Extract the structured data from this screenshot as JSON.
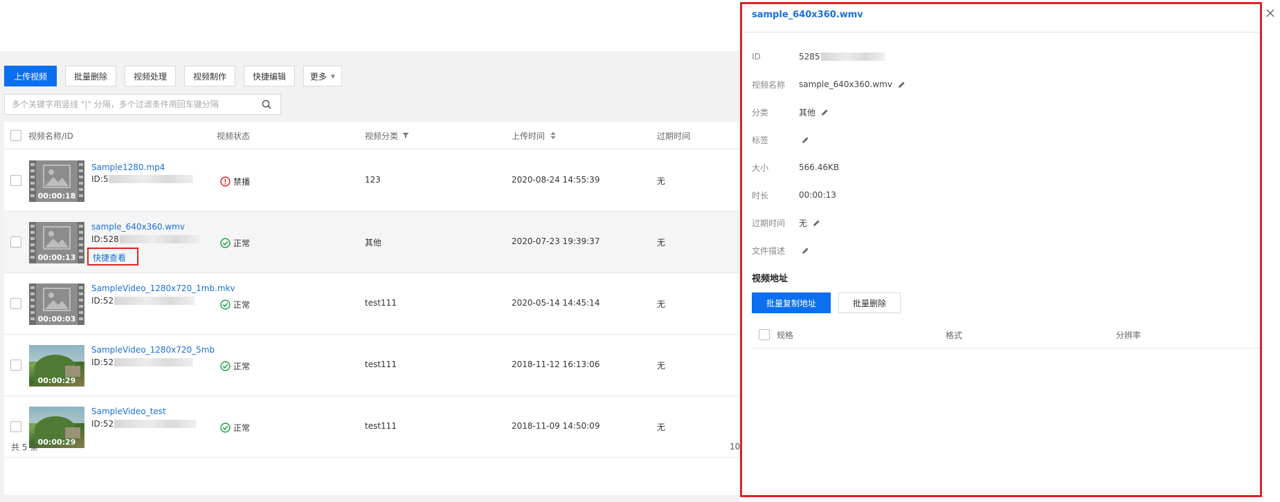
{
  "toolbar": {
    "upload": "上传视频",
    "batch_delete": "批量删除",
    "video_process": "视频处理",
    "video_make": "视频制作",
    "quick_edit": "快捷编辑",
    "more": "更多"
  },
  "search": {
    "placeholder": "多个关键字用竖线 \"|\" 分隔，多个过滤条件用回车键分隔"
  },
  "table": {
    "columns": {
      "name": "视频名称/ID",
      "status": "视频状态",
      "category": "视频分类",
      "upload_time": "上传时间",
      "expire": "过期时间"
    },
    "rows": [
      {
        "name": "Sample1280.mp4",
        "id_prefix": "ID:5",
        "duration": "00:00:18",
        "status": "禁播",
        "status_kind": "banned",
        "category": "123",
        "upload_time": "2020-08-24 14:55:39",
        "expire": "无"
      },
      {
        "name": "sample_640x360.wmv",
        "id_prefix": "ID:528",
        "duration": "00:00:13",
        "status": "正常",
        "status_kind": "ok",
        "category": "其他",
        "upload_time": "2020-07-23 19:39:37",
        "expire": "无",
        "quick_view": "快捷查看"
      },
      {
        "name": "SampleVideo_1280x720_1mb.mkv",
        "id_prefix": "ID:52",
        "duration": "00:00:03",
        "status": "正常",
        "status_kind": "ok",
        "category": "test111",
        "upload_time": "2020-05-14 14:45:14",
        "expire": "无"
      },
      {
        "name": "SampleVideo_1280x720_5mb",
        "id_prefix": "ID:52",
        "duration": "00:00:29",
        "status": "正常",
        "status_kind": "ok",
        "category": "test111",
        "upload_time": "2018-11-12 16:13:06",
        "expire": "无"
      },
      {
        "name": "SampleVideo_test",
        "id_prefix": "ID:52",
        "duration": "00:00:29",
        "status": "正常",
        "status_kind": "ok",
        "category": "test111",
        "upload_time": "2018-11-09 14:50:09",
        "expire": "无"
      }
    ],
    "total": "共 5 条",
    "page_size": "10"
  },
  "panel": {
    "title": "sample_640x360.wmv",
    "fields": {
      "id_label": "ID",
      "id_value": "5285",
      "name_label": "视频名称",
      "name_value": "sample_640x360.wmv",
      "category_label": "分类",
      "category_value": "其他",
      "tag_label": "标签",
      "size_label": "大小",
      "size_value": "566.46KB",
      "duration_label": "时长",
      "duration_value": "00:00:13",
      "expire_label": "过期时间",
      "expire_value": "无",
      "desc_label": "文件描述"
    },
    "address_section": "视频地址",
    "copy_button": "批量复制地址",
    "delete_button": "批量删除",
    "columns": {
      "spec": "规格",
      "format": "格式",
      "resolution": "分辨率"
    }
  },
  "colors": {
    "primary": "#0a6ff0",
    "link": "#1a6fd8",
    "highlight_border": "#e02020",
    "ok": "#1aa34a",
    "banned": "#e02020"
  },
  "icons": [
    "search-icon",
    "filter-icon",
    "sort-icon",
    "edit-icon",
    "close-icon",
    "check-circle-icon",
    "alert-circle-icon",
    "image-placeholder-icon",
    "chevron-down-icon"
  ]
}
